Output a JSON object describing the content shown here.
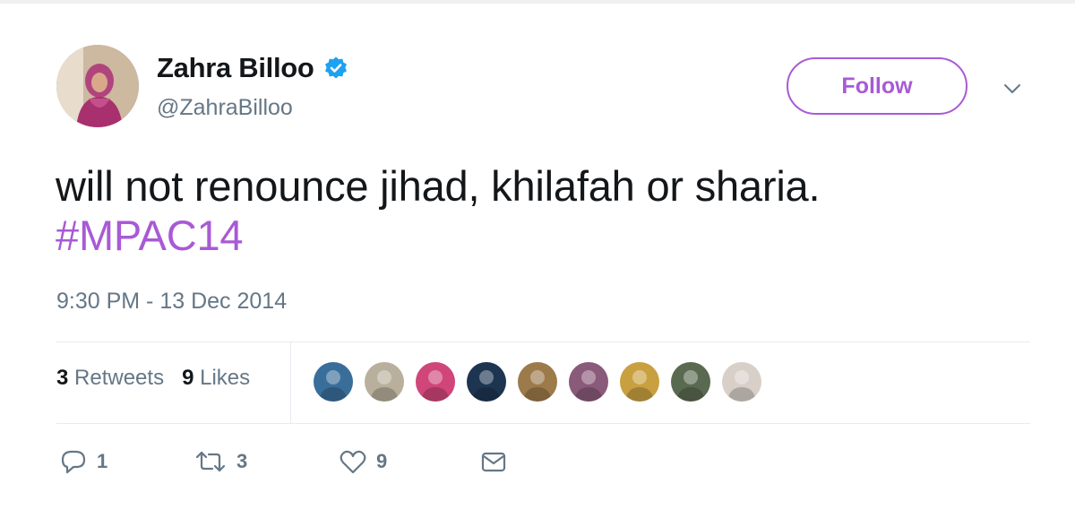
{
  "author": {
    "name": "Zahra Billoo",
    "handle": "@ZahraBilloo",
    "verified": true
  },
  "follow_button": {
    "label": "Follow"
  },
  "tweet": {
    "text": "will not renounce jihad, khilafah or sharia.",
    "hashtag": "#MPAC14",
    "timestamp": "9:30 PM - 13 Dec 2014"
  },
  "stats": {
    "retweets_count": "3",
    "retweets_label": "Retweets",
    "likes_count": "9",
    "likes_label": "Likes"
  },
  "likers": [
    {
      "color": "#3a6e9a"
    },
    {
      "color": "#b8b09c"
    },
    {
      "color": "#d0457a"
    },
    {
      "color": "#1e3552"
    },
    {
      "color": "#9c7a4a"
    },
    {
      "color": "#8a5a7a"
    },
    {
      "color": "#c9a040"
    },
    {
      "color": "#5a6a50"
    },
    {
      "color": "#d8d0c8"
    }
  ],
  "actions": {
    "reply_count": "1",
    "retweet_count": "3",
    "like_count": "9",
    "reply_icon": "reply-icon",
    "retweet_icon": "retweet-icon",
    "like_icon": "heart-icon",
    "message_icon": "envelope-icon"
  },
  "colors": {
    "accent": "#a85ad6",
    "secondary_text": "#657786",
    "verified_blue": "#1da1f2"
  }
}
